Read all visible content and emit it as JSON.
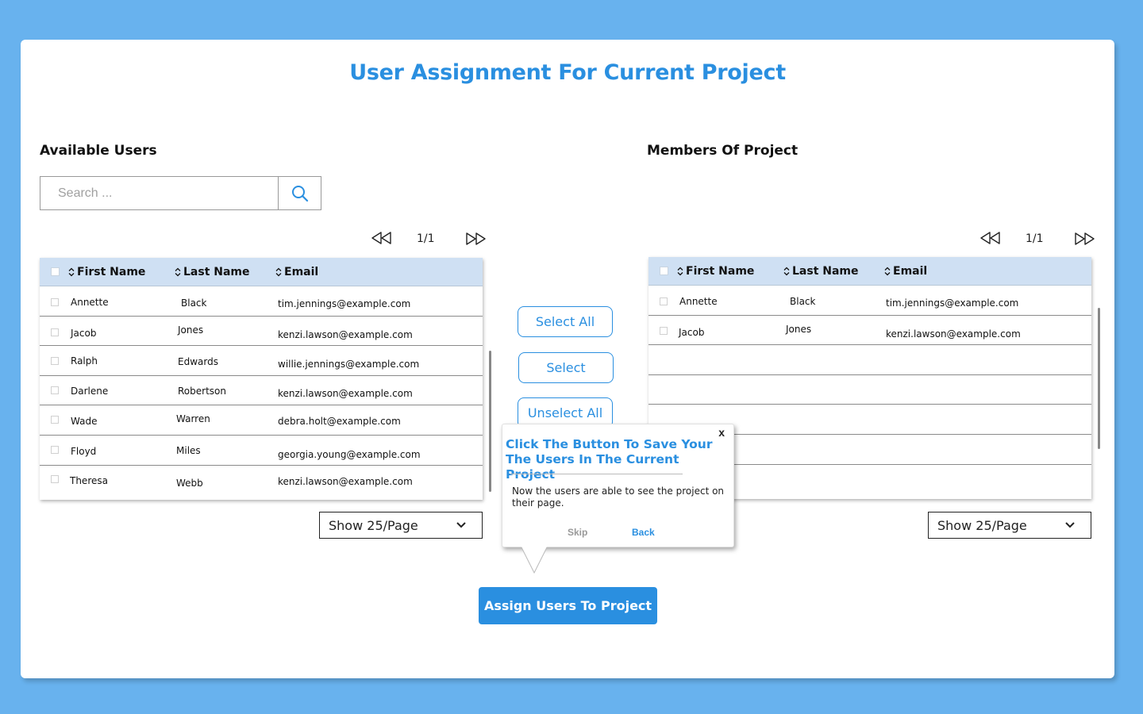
{
  "page": {
    "title": "User Assignment For Current Project"
  },
  "available": {
    "title": "Available Users",
    "search_placeholder": "Search ...",
    "pager": "1/1",
    "columns": {
      "first": "First Name",
      "last": "Last Name",
      "email": "Email"
    },
    "rows": [
      {
        "first": "Annette",
        "last": "Black",
        "email": "tim.jennings@example.com"
      },
      {
        "first": "Jacob",
        "last": "Jones",
        "email": "kenzi.lawson@example.com"
      },
      {
        "first": "Ralph",
        "last": "Edwards",
        "email": "willie.jennings@example.com"
      },
      {
        "first": "Darlene",
        "last": "Robertson",
        "email": "kenzi.lawson@example.com"
      },
      {
        "first": "Wade",
        "last": "Warren",
        "email": "debra.holt@example.com"
      },
      {
        "first": "Floyd",
        "last": "Miles",
        "email": "georgia.young@example.com"
      },
      {
        "first": "Theresa",
        "last": "Webb",
        "email": "kenzi.lawson@example.com"
      }
    ],
    "page_size": "Show 25/Page"
  },
  "members": {
    "title": "Members Of Project",
    "pager": "1/1",
    "columns": {
      "first": "First Name",
      "last": "Last Name",
      "email": "Email"
    },
    "rows": [
      {
        "first": "Annette",
        "last": "Black",
        "email": "tim.jennings@example.com"
      },
      {
        "first": "Jacob",
        "last": "Jones",
        "email": "kenzi.lawson@example.com"
      }
    ],
    "page_size": "Show 25/Page"
  },
  "actions": {
    "select_all": "Select All",
    "select": "Select",
    "unselect_all": "Unselect All",
    "assign": "Assign Users To Project"
  },
  "tooltip": {
    "close": "x",
    "title": "Click The Button To Save Your The Users In The Current Project",
    "body": "Now the users are able to see the project on their page.",
    "skip": "Skip",
    "back": "Back"
  },
  "icons": {
    "search": "search-icon",
    "prev": "rewind-icon",
    "next": "fast-forward-icon",
    "dropdown": "chevron-down-icon",
    "sort": "sort-icon"
  },
  "colors": {
    "background": "#68b2ee",
    "accent": "#2a8fe0",
    "table_header": "#cfe0f3"
  }
}
